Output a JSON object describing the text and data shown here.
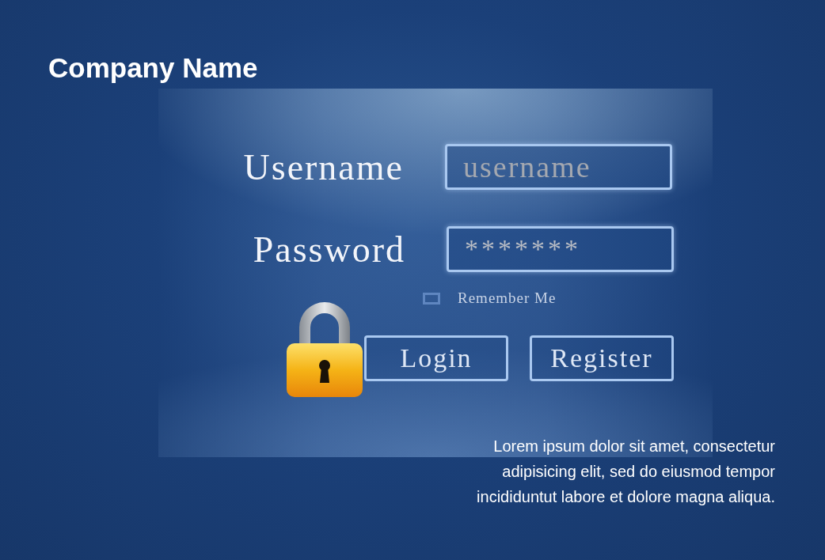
{
  "company_name": "Company Name",
  "form": {
    "username": {
      "label": "Username",
      "placeholder": "username"
    },
    "password": {
      "label": "Password",
      "value": "*******"
    },
    "remember": {
      "label": "Remember Me",
      "checked": false
    },
    "buttons": [
      "Login",
      "Register"
    ]
  },
  "footer_text": "Lorem ipsum dolor sit amet, consectetur adipisicing elit, sed do eiusmod tempor incididuntut labore et dolore magna aliqua."
}
